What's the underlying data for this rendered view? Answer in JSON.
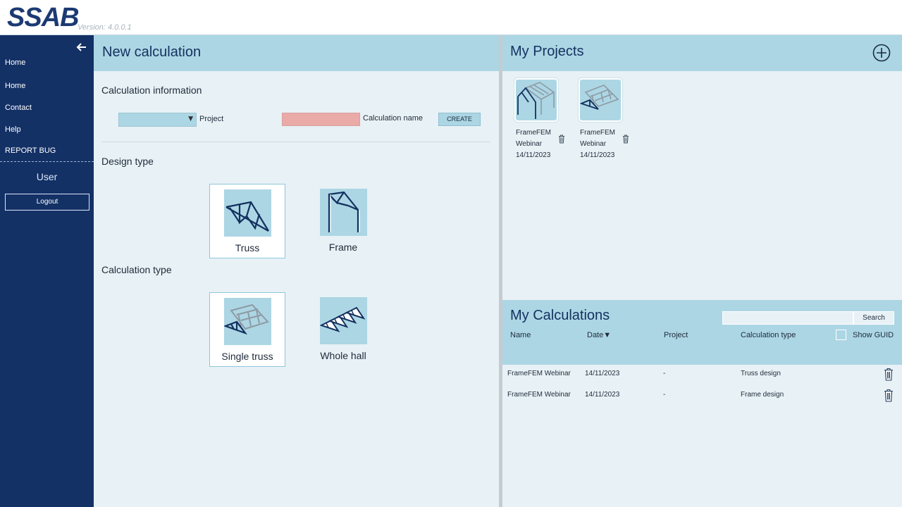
{
  "app": {
    "logo": "SSAB",
    "version": "Version: 4.0.0.1"
  },
  "sidebar": {
    "items": [
      {
        "label": "Home"
      },
      {
        "label": "Home"
      },
      {
        "label": "Contact"
      },
      {
        "label": "Help"
      },
      {
        "label": "REPORT BUG"
      }
    ],
    "user_label": "User",
    "logout_label": "Logout"
  },
  "new_calc": {
    "title": "New calculation",
    "info_label": "Calculation information",
    "project_label": "Project",
    "project_value": "",
    "calc_name_label": "Calculation name",
    "calc_name_value": "",
    "create_label": "CREATE",
    "design_type_label": "Design type",
    "design_types": [
      {
        "label": "Truss",
        "selected": true
      },
      {
        "label": "Frame",
        "selected": false
      }
    ],
    "calc_type_label": "Calculation type",
    "calc_types": [
      {
        "label": "Single truss",
        "selected": true
      },
      {
        "label": "Whole hall",
        "selected": false
      }
    ]
  },
  "projects": {
    "title": "My Projects",
    "items": [
      {
        "line1": "FrameFEM",
        "line2": "Webinar",
        "date": "14/11/2023"
      },
      {
        "line1": "FrameFEM",
        "line2": "Webinar",
        "date": "14/11/2023"
      }
    ]
  },
  "calculations": {
    "title": "My Calculations",
    "search_value": "",
    "search_label": "Search",
    "columns": {
      "name": "Name",
      "date": "Date▼",
      "project": "Project",
      "calc_type": "Calculation type",
      "show_guid": "Show GUID"
    },
    "rows": [
      {
        "name": "FrameFEM Webinar",
        "date": "14/11/2023",
        "project": "-",
        "type": "Truss design"
      },
      {
        "name": "FrameFEM Webinar",
        "date": "14/11/2023",
        "project": "-",
        "type": "Frame design"
      }
    ]
  },
  "colors": {
    "sidebar": "#143166",
    "panel": "#e8f1f5",
    "header": "#acd6e4",
    "accent_dark": "#13315f",
    "name_input": "#e9aaa8"
  }
}
